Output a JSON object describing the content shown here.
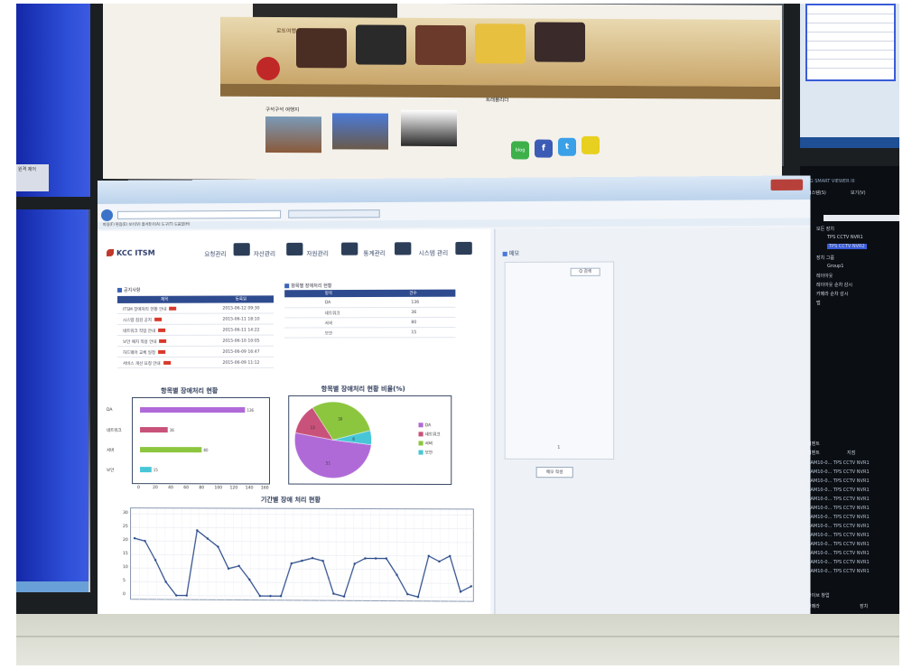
{
  "window": {
    "address": "http://itsm.kcc.co.kr/ui/main.do",
    "tab": "장애처리시스템",
    "menubar": "파일(F)  편집(E)  보기(V)  즐겨찾기(A)  도구(T)  도움말(H)"
  },
  "app": {
    "logo": "KCC ITSM",
    "menu": [
      "요청관리",
      "자산관리",
      "자원관리",
      "통계관리",
      "시스템 관리"
    ]
  },
  "notices": {
    "title": "공지사항",
    "headers": [
      "제목",
      "등록일"
    ],
    "rows": [
      {
        "title": "ITSM 장애처리 현황 안내",
        "date": "2015-06-12 09:30"
      },
      {
        "title": "시스템 점검 공지",
        "date": "2015-06-11 18:10"
      },
      {
        "title": "네트워크 작업 안내",
        "date": "2015-06-11 14:22"
      },
      {
        "title": "보안 패치 적용 안내",
        "date": "2015-06-10 10:05"
      },
      {
        "title": "하드웨어 교체 일정",
        "date": "2015-06-09 16:47"
      },
      {
        "title": "서비스 개선 요청 안내",
        "date": "2015-06-09 11:12"
      }
    ]
  },
  "status_table": {
    "title": "항목별 장애처리 현황",
    "headers": [
      "항목",
      "건수"
    ],
    "rows": [
      {
        "item": "DA",
        "count": "136"
      },
      {
        "item": "네트워크",
        "count": "36"
      },
      {
        "item": "서버",
        "count": "80"
      },
      {
        "item": "보안",
        "count": "15"
      }
    ]
  },
  "chart_data": [
    {
      "type": "bar",
      "title": "항목별 장애처리 현황",
      "categories": [
        "DA",
        "네트워크",
        "서버",
        "보안"
      ],
      "values": [
        136,
        36,
        80,
        15
      ],
      "xlim": [
        0,
        160
      ],
      "ticks": [
        "0",
        "20",
        "40",
        "60",
        "80",
        "100",
        "120",
        "140",
        "160"
      ],
      "colors": [
        "#b06ad8",
        "#c8527a",
        "#8cc63f",
        "#48c6d8"
      ]
    },
    {
      "type": "pie",
      "title": "항목별 장애처리 현황 비율(%)",
      "categories": [
        "DA",
        "네트워크",
        "서버",
        "보안"
      ],
      "values": [
        51,
        13,
        30,
        6
      ],
      "colors": [
        "#b06ad8",
        "#c8527a",
        "#8cc63f",
        "#48c6d8"
      ]
    },
    {
      "type": "line",
      "title": "기간별 장애 처리 현황",
      "ylim": [
        0,
        30
      ],
      "yticks": [
        "0",
        "5",
        "10",
        "15",
        "20",
        "25",
        "30"
      ],
      "values": [
        21,
        20,
        13,
        5,
        0,
        0,
        24,
        21,
        18,
        10,
        11,
        6,
        0,
        0,
        0,
        12,
        13,
        14,
        13,
        1,
        0,
        12,
        14,
        14,
        14,
        8,
        1,
        0,
        15,
        13,
        15,
        2,
        4
      ],
      "color": "#2a4a8a"
    }
  ],
  "memo": {
    "title": "메모",
    "search": "Q 검색",
    "write": "메모 작성",
    "count": "1"
  },
  "top_site": {
    "heading": "로또여행의 최고봉!",
    "section": "구석구석 여행지",
    "recommend": "트래블리더",
    "social": [
      "blog",
      "f",
      "t"
    ]
  },
  "right_app": {
    "title": "LG SMART VIEWER III",
    "menu": [
      "시스템(S)",
      "보기(V)"
    ],
    "tree": [
      "모든 장치",
      "TPS CCTV NVR1",
      "TPS CCTV NVR2",
      "장치 그룹",
      "Group1",
      "레이아웃",
      "레이아웃 순차 감시",
      "카메라 순차 감시",
      "맵"
    ],
    "events_title": "이벤트",
    "events_headers": [
      "이벤트",
      "지점"
    ],
    "event_row": "CAM10-0...  TPS CCTV NVR1",
    "bottom_title": "라이브 창업",
    "bottom_headers": [
      "카메라",
      "장치"
    ]
  },
  "left_dialog": "원격 제어"
}
